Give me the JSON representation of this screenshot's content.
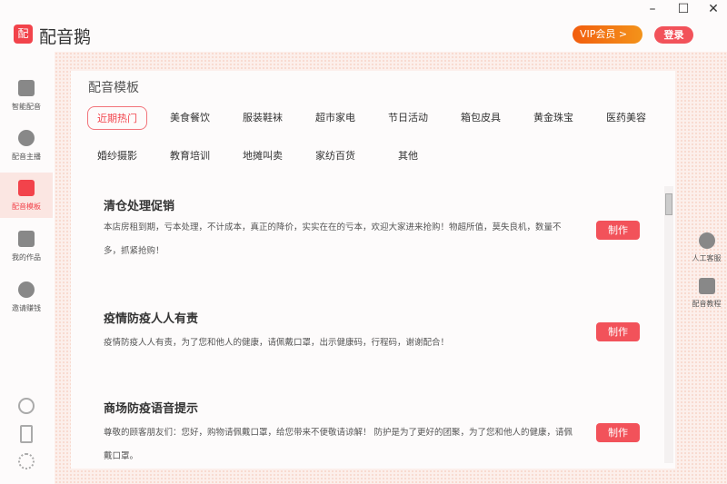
{
  "app": {
    "logo": "配",
    "title": "配音鹅",
    "vip": "VIP会员 >",
    "login": "登录",
    "window": {
      "minimize": "–",
      "maximize": "☐",
      "close": "✕"
    }
  },
  "sidebar": [
    {
      "label": "智能配音",
      "icon": "speaker-icon"
    },
    {
      "label": "配音主播",
      "icon": "anchor-icon"
    },
    {
      "label": "配音模板",
      "icon": "template-icon"
    },
    {
      "label": "我的作品",
      "icon": "folder-icon"
    },
    {
      "label": "邀请赚钱",
      "icon": "money-bag-icon"
    }
  ],
  "right": [
    {
      "label": "人工客服",
      "icon": "headset-icon"
    },
    {
      "label": "配音教程",
      "icon": "tutorial-icon"
    }
  ],
  "main": {
    "heading": "配音模板",
    "tabs": [
      "近期热门",
      "美食餐饮",
      "服装鞋袜",
      "超市家电",
      "节日活动",
      "箱包皮具",
      "黄金珠宝",
      "医药美容",
      "婚纱摄影",
      "教育培训",
      "地摊叫卖",
      "家纺百货",
      "其他"
    ],
    "make_label": "制作",
    "cards": [
      {
        "title": "清仓处理促销",
        "desc": "本店房租到期，亏本处理，不计成本，真正的降价，实实在在的亏本，欢迎大家进来抢购！物超所值，莫失良机，数量不多，抓紧抢购！"
      },
      {
        "title": "疫情防疫人人有责",
        "desc": "疫情防疫人人有责，为了您和他人的健康，请佩戴口罩，出示健康码，行程码，谢谢配合！"
      },
      {
        "title": "商场防疫语音提示",
        "desc": "尊敬的顾客朋友们：您好，购物请佩戴口罩，给您带来不便敬请谅解！ 防护是为了更好的团聚，为了您和他人的健康，请佩戴口罩。"
      }
    ]
  },
  "colors": {
    "accent": "#f2434b"
  }
}
